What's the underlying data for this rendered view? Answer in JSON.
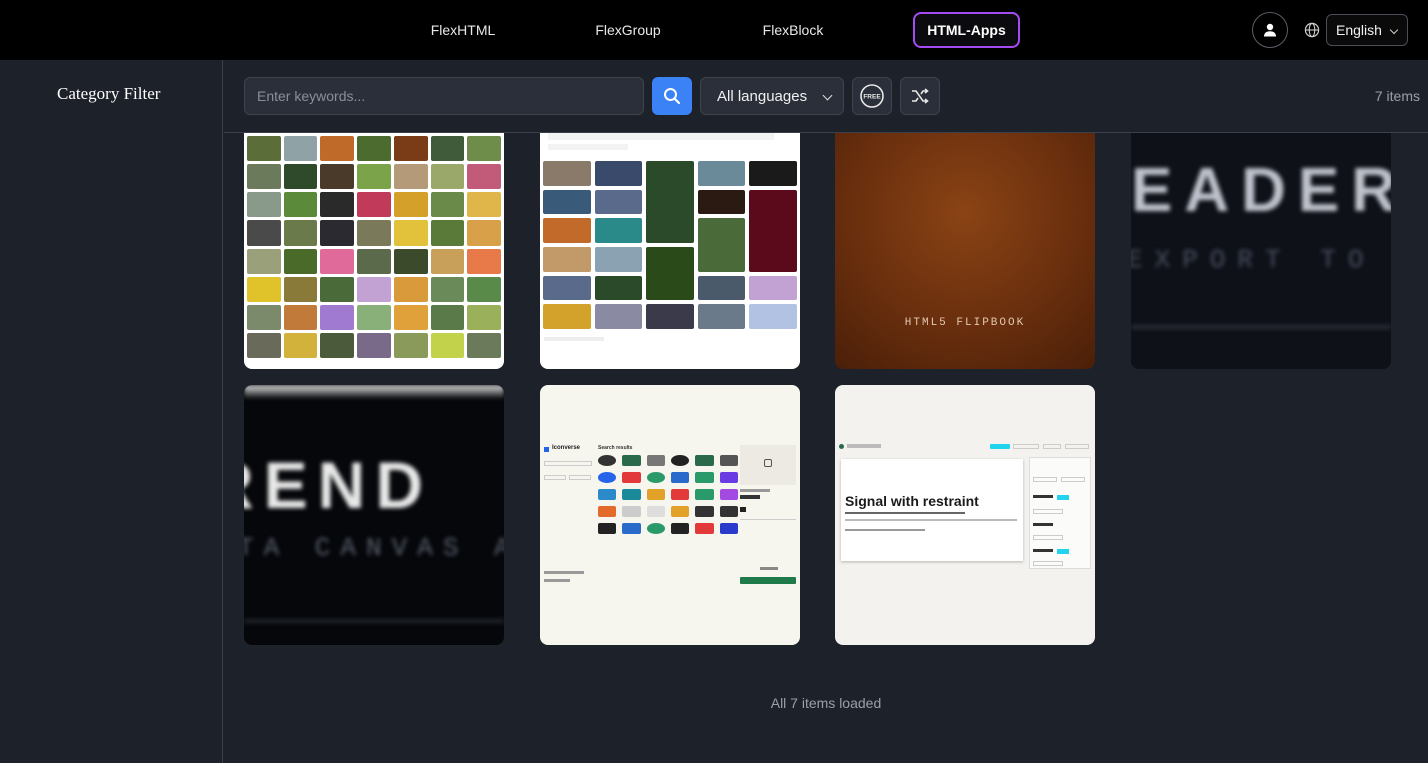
{
  "nav": {
    "tabs": [
      {
        "label": "FlexHTML",
        "active": false
      },
      {
        "label": "FlexGroup",
        "active": false
      },
      {
        "label": "FlexBlock",
        "active": false
      },
      {
        "label": "HTML-Apps",
        "active": true
      }
    ],
    "language": "English",
    "user_icon": "user-icon",
    "globe_icon": "globe-icon"
  },
  "sidebar": {
    "title": "Category Filter"
  },
  "toolbar": {
    "search_placeholder": "Enter keywords...",
    "search_icon": "search-icon",
    "language_filter": "All languages",
    "free_badge": "FREE",
    "shuffle_icon": "shuffle-icon",
    "items_count": "7 items"
  },
  "gallery": {
    "cards": [
      {
        "label": "flower-photo-gallery-thumbnail"
      },
      {
        "label": "photo-search-gallery-thumbnail"
      },
      {
        "label": "html5-flipbook-thumbnail",
        "overlay_text": "HTML5 FLIPBOOK"
      },
      {
        "label": "reader-thumbnail",
        "overlay_title": "EADER",
        "overlay_sub": "EXPORT TO V"
      },
      {
        "label": "render-thumbnail",
        "overlay_title": "REND",
        "overlay_sub": "TA CANVAS AS"
      },
      {
        "label": "icon-search-thumbnail",
        "app_name": "Iconverse",
        "heading": "Search results"
      },
      {
        "label": "typography-tool-thumbnail",
        "headline": "Signal with restraint"
      }
    ],
    "status": "All 7 items loaded"
  },
  "colors": {
    "accent_purple": "#a64bf4",
    "search_blue": "#3b82f6",
    "background": "#1d212a"
  }
}
